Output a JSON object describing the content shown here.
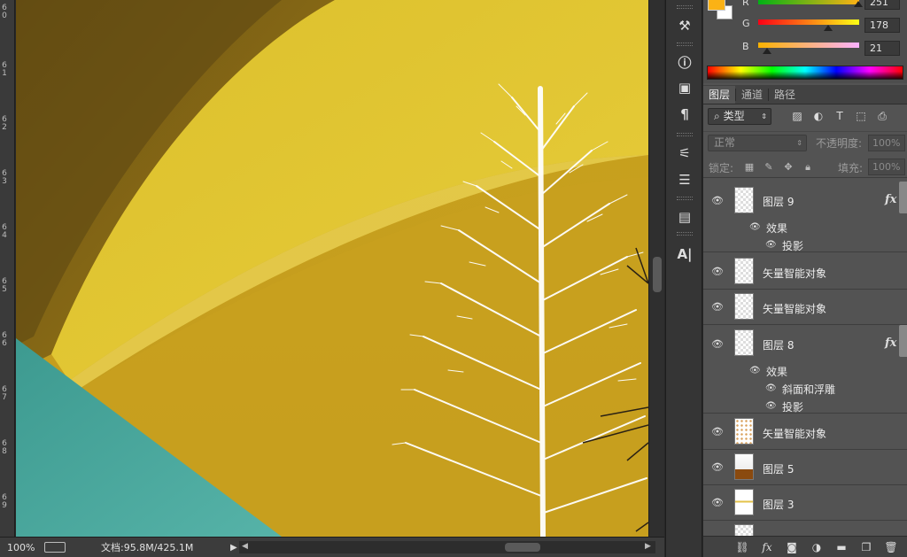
{
  "ruler": {
    "ticks": [
      "6\n0",
      "6\n1",
      "6\n2",
      "6\n3",
      "6\n4",
      "6\n5",
      "6\n6",
      "6\n7",
      "6\n8",
      "6\n9"
    ]
  },
  "status": {
    "zoom": "100%",
    "doc_info": "文档:95.8M/425.1M"
  },
  "color_panel": {
    "foreground_color": "#fbb215",
    "background_color": "#ffffff",
    "r_label": "R",
    "r_value": "251",
    "g_label": "G",
    "g_value": "178",
    "b_label": "B",
    "b_value": "21"
  },
  "layers_panel": {
    "tabs": [
      "图层",
      "通道",
      "路径"
    ],
    "filter_label": "类型",
    "blend_mode": "正常",
    "opacity_label": "不透明度:",
    "opacity_value": "100%",
    "lock_label": "锁定:",
    "fill_label": "填充:",
    "fill_value": "100%",
    "layers": [
      {
        "name": "图层 9",
        "visible": true,
        "fx": true,
        "thumb": "empty",
        "effects_label": "效果",
        "effects": [
          "投影"
        ]
      },
      {
        "name": "矢量智能对象",
        "visible": true,
        "fx": false,
        "thumb": "empty"
      },
      {
        "name": "矢量智能对象",
        "visible": true,
        "fx": false,
        "thumb": "empty"
      },
      {
        "name": "图层 8",
        "visible": true,
        "fx": true,
        "thumb": "empty",
        "effects_label": "效果",
        "effects": [
          "斜面和浮雕",
          "投影"
        ]
      },
      {
        "name": "矢量智能对象",
        "visible": true,
        "fx": false,
        "thumb": "dots"
      },
      {
        "name": "图层 5",
        "visible": true,
        "fx": false,
        "thumb": "brown"
      },
      {
        "name": "图层 3",
        "visible": true,
        "fx": false,
        "thumb": "line"
      }
    ]
  },
  "fx_label": "fx",
  "tool_labels": {
    "character_tool": "A|"
  },
  "colors": {
    "canvas_gold": "#c7a01d",
    "teal": "#47a49a",
    "panel_bg": "#535353"
  }
}
